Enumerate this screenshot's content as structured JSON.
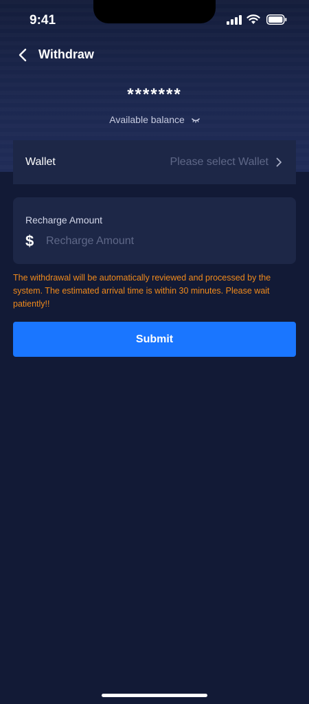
{
  "status_bar": {
    "time": "9:41",
    "icons": [
      "cellular-signal-icon",
      "wifi-icon",
      "battery-icon"
    ]
  },
  "nav": {
    "title": "Withdraw",
    "back_icon": "chevron-left-icon"
  },
  "balance": {
    "masked_value": "*******",
    "label": "Available balance",
    "toggle_icon": "eye-closed-icon"
  },
  "wallet": {
    "label": "Wallet",
    "placeholder": "Please select Wallet",
    "icon": "chevron-right-icon"
  },
  "amount": {
    "label": "Recharge Amount",
    "currency_symbol": "$",
    "placeholder": "Recharge Amount",
    "value": ""
  },
  "notice": "The withdrawal will be automatically reviewed and processed by the system. The estimated arrival time is within 30 minutes. Please wait patiently!!",
  "submit_label": "Submit",
  "colors": {
    "background": "#121a36",
    "card": "#1d2747",
    "accent": "#1a76ff",
    "warning": "#f08a1c",
    "placeholder": "#5f6888"
  }
}
